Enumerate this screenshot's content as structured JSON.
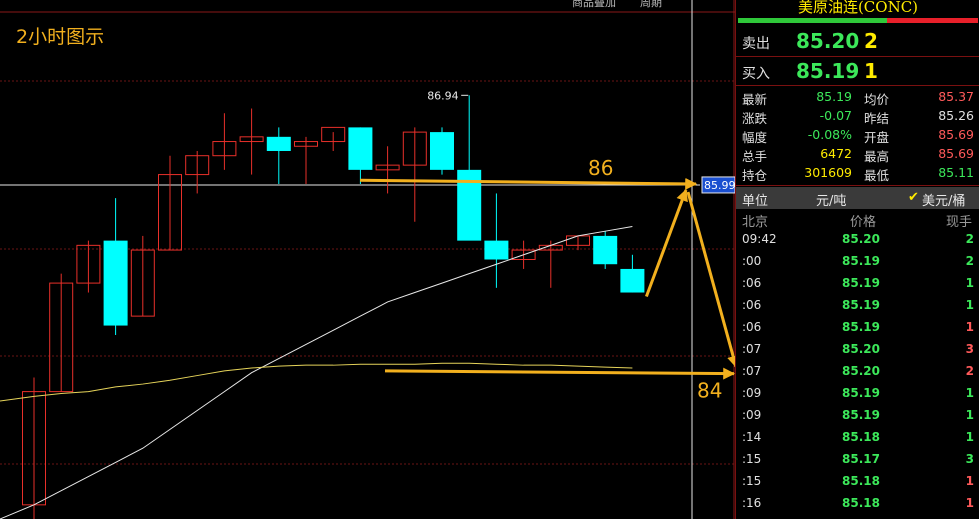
{
  "chart_data": {
    "type": "candlestick",
    "title": "2小时图示",
    "ylim": [
      82.45,
      87.95
    ],
    "candles": [
      {
        "o": 82.6,
        "h": 83.95,
        "l": 82.4,
        "c": 83.8
      },
      {
        "o": 83.8,
        "h": 85.05,
        "l": 83.8,
        "c": 84.95
      },
      {
        "o": 84.95,
        "h": 85.4,
        "l": 84.85,
        "c": 85.35
      },
      {
        "o": 85.4,
        "h": 85.85,
        "l": 84.4,
        "c": 84.5
      },
      {
        "o": 84.6,
        "h": 85.45,
        "l": 84.6,
        "c": 85.3
      },
      {
        "o": 85.3,
        "h": 86.3,
        "l": 85.3,
        "c": 86.1
      },
      {
        "o": 86.1,
        "h": 86.35,
        "l": 85.9,
        "c": 86.3
      },
      {
        "o": 86.3,
        "h": 86.75,
        "l": 86.15,
        "c": 86.45
      },
      {
        "o": 86.45,
        "h": 86.8,
        "l": 86.1,
        "c": 86.5
      },
      {
        "o": 86.5,
        "h": 86.6,
        "l": 86.0,
        "c": 86.35
      },
      {
        "o": 86.4,
        "h": 86.5,
        "l": 86.0,
        "c": 86.45
      },
      {
        "o": 86.45,
        "h": 86.55,
        "l": 86.35,
        "c": 86.6
      },
      {
        "o": 86.6,
        "h": 86.6,
        "l": 86.0,
        "c": 86.15
      },
      {
        "o": 86.15,
        "h": 86.4,
        "l": 85.9,
        "c": 86.2
      },
      {
        "o": 86.2,
        "h": 86.6,
        "l": 85.6,
        "c": 86.55
      },
      {
        "o": 86.55,
        "h": 86.6,
        "l": 86.1,
        "c": 86.15
      },
      {
        "o": 86.15,
        "h": 86.94,
        "l": 85.8,
        "c": 85.4
      },
      {
        "o": 85.4,
        "h": 85.9,
        "l": 84.9,
        "c": 85.2
      },
      {
        "o": 85.2,
        "h": 85.4,
        "l": 85.1,
        "c": 85.3
      },
      {
        "o": 85.3,
        "h": 85.4,
        "l": 84.9,
        "c": 85.35
      },
      {
        "o": 85.35,
        "h": 85.45,
        "l": 85.3,
        "c": 85.45
      },
      {
        "o": 85.45,
        "h": 85.5,
        "l": 85.1,
        "c": 85.15
      },
      {
        "o": 85.1,
        "h": 85.25,
        "l": 84.85,
        "c": 84.85
      }
    ],
    "ma_short": [
      82.45,
      82.6,
      82.75,
      82.9,
      83.05,
      83.2,
      83.4,
      83.6,
      83.8,
      84.0,
      84.15,
      84.3,
      84.45,
      84.6,
      84.75,
      84.85,
      84.95,
      85.05,
      85.15,
      85.25,
      85.35,
      85.45,
      85.5,
      85.55
    ],
    "ma_long": [
      83.7,
      83.75,
      83.78,
      83.8,
      83.85,
      83.88,
      83.92,
      83.97,
      84.02,
      84.05,
      84.07,
      84.08,
      84.08,
      84.09,
      84.09,
      84.09,
      84.1,
      84.1,
      84.09,
      84.08,
      84.08,
      84.07,
      84.06,
      84.05
    ],
    "high_label": "86.94",
    "ref_price": 85.99,
    "ref_price_label": "85.99",
    "target_up": "86",
    "target_down": "84",
    "colors": {
      "up": "#e8302a",
      "down": "#00ffff",
      "ma_short": "#e8e8e8",
      "ma_long": "#e6d45a",
      "arrow": "#f2b01e"
    }
  },
  "toolbar": {
    "item1": "商品叠加",
    "item2": "周期"
  },
  "panel": {
    "title": "美原油连(CONC)",
    "bar_green_pct": 62,
    "sell": {
      "label": "卖出",
      "price": "85.20",
      "vol": "2"
    },
    "buy": {
      "label": "买入",
      "price": "85.19",
      "vol": "1"
    },
    "stats": [
      {
        "l1": "最新",
        "v1": "85.19",
        "c1": "#3ce85a",
        "l2": "均价",
        "v2": "85.37",
        "c2": "#ff5a5a"
      },
      {
        "l1": "涨跌",
        "v1": "-0.07",
        "c1": "#3ce85a",
        "l2": "昨结",
        "v2": "85.26",
        "c2": "#e0e0e0"
      },
      {
        "l1": "幅度",
        "v1": "-0.08%",
        "c1": "#3ce85a",
        "l2": "开盘",
        "v2": "85.69",
        "c2": "#ff5a5a"
      },
      {
        "l1": "总手",
        "v1": "6472",
        "c1": "#ffeb00",
        "l2": "最高",
        "v2": "85.69",
        "c2": "#ff5a5a"
      },
      {
        "l1": "持仓",
        "v1": "301609",
        "c1": "#ffeb00",
        "l2": "最低",
        "v2": "85.11",
        "c2": "#3ce85a"
      }
    ],
    "unit": {
      "label": "单位",
      "value": "元/吨",
      "check": "✔",
      "alt": "美元/桶"
    },
    "cols": {
      "time": "北京",
      "price": "价格",
      "vol": "现手"
    },
    "ticks": [
      {
        "time": "09:42",
        "price": "85.20",
        "vol": "2",
        "vc": "#3ce85a"
      },
      {
        "time": ":00",
        "price": "85.19",
        "vol": "2",
        "vc": "#3ce85a"
      },
      {
        "time": ":06",
        "price": "85.19",
        "vol": "1",
        "vc": "#3ce85a"
      },
      {
        "time": ":06",
        "price": "85.19",
        "vol": "1",
        "vc": "#3ce85a"
      },
      {
        "time": ":06",
        "price": "85.19",
        "vol": "1",
        "vc": "#ff5a5a"
      },
      {
        "time": ":07",
        "price": "85.20",
        "vol": "3",
        "vc": "#ff5a5a"
      },
      {
        "time": ":07",
        "price": "85.20",
        "vol": "2",
        "vc": "#ff5a5a"
      },
      {
        "time": ":09",
        "price": "85.19",
        "vol": "1",
        "vc": "#3ce85a"
      },
      {
        "time": ":09",
        "price": "85.19",
        "vol": "1",
        "vc": "#3ce85a"
      },
      {
        "time": ":14",
        "price": "85.18",
        "vol": "1",
        "vc": "#3ce85a"
      },
      {
        "time": ":15",
        "price": "85.17",
        "vol": "3",
        "vc": "#3ce85a"
      },
      {
        "time": ":15",
        "price": "85.18",
        "vol": "1",
        "vc": "#ff5a5a"
      },
      {
        "time": ":16",
        "price": "85.18",
        "vol": "1",
        "vc": "#ff5a5a"
      }
    ]
  }
}
